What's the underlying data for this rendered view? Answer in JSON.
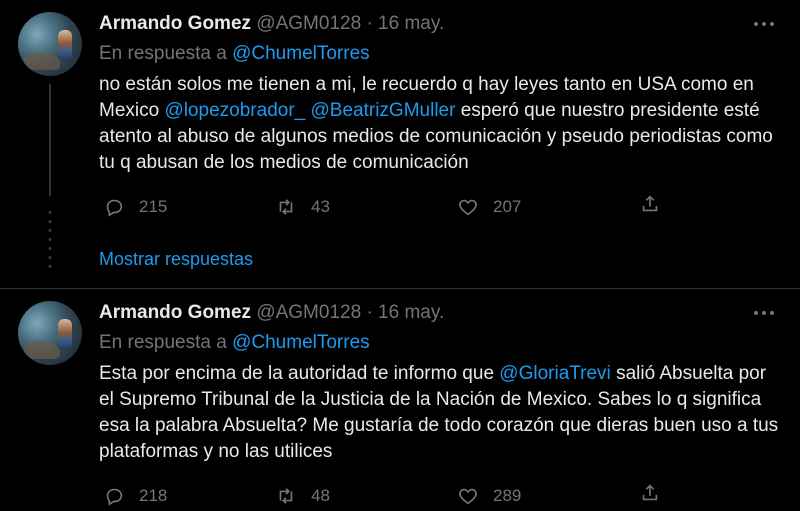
{
  "colors": {
    "background": "#000000",
    "text": "#e7e9ea",
    "muted": "#71767b",
    "link": "#1d9bf0",
    "divider": "#2f3336"
  },
  "tweets": [
    {
      "author_name": "Armando Gomez",
      "handle": "@AGM0128",
      "separator": "·",
      "date": "16 may.",
      "reply_prefix": "En respuesta a",
      "reply_to": "@ChumelTorres",
      "body": [
        {
          "t": "text",
          "v": "no están solos me tienen a mi, le recuerdo q hay leyes tanto en USA como en Mexico "
        },
        {
          "t": "mention",
          "v": "@lopezobrador_"
        },
        {
          "t": "text",
          "v": " "
        },
        {
          "t": "mention",
          "v": "@BeatrizGMuller"
        },
        {
          "t": "text",
          "v": " esperó que  nuestro presidente esté atento al abuso de algunos medios de comunicación y pseudo periodistas como tu q abusan de los medios de comunicación"
        }
      ],
      "replies": "215",
      "retweets": "43",
      "likes": "207",
      "show_replies": "Mostrar respuestas"
    },
    {
      "author_name": "Armando Gomez",
      "handle": "@AGM0128",
      "separator": "·",
      "date": "16 may.",
      "reply_prefix": "En respuesta a",
      "reply_to": "@ChumelTorres",
      "body": [
        {
          "t": "text",
          "v": "Esta por encima de la autoridad te informo que "
        },
        {
          "t": "mention",
          "v": "@GloriaTrevi"
        },
        {
          "t": "text",
          "v": " salió Absuelta por el Supremo Tribunal de la Justicia de la Nación de Mexico. Sabes lo q significa esa la palabra Absuelta? Me gustaría de todo corazón que dieras buen uso a tus plataformas y no las utilices"
        }
      ],
      "replies": "218",
      "retweets": "48",
      "likes": "289"
    }
  ],
  "icons": [
    "reply-icon",
    "retweet-icon",
    "like-icon",
    "share-icon",
    "more-icon"
  ]
}
